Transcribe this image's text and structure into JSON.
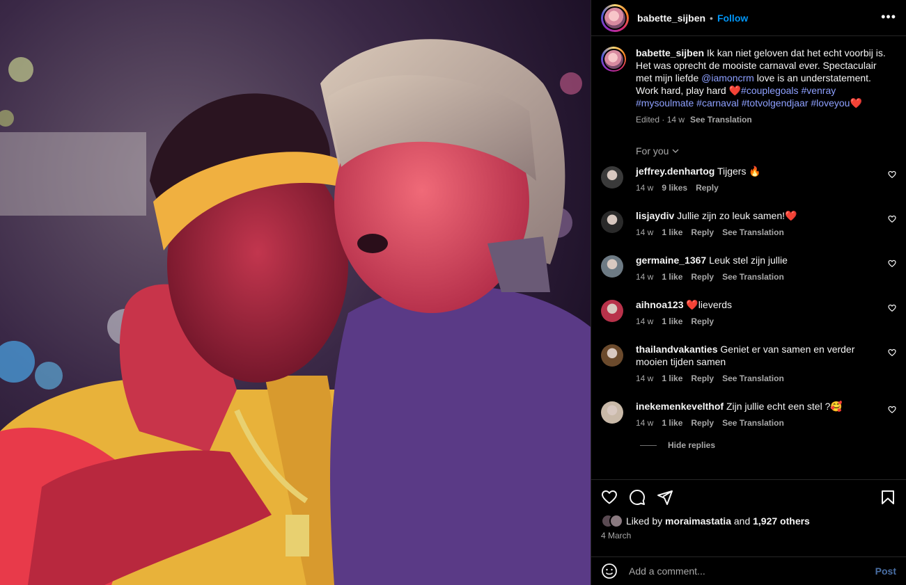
{
  "post": {
    "username": "babette_sijben",
    "follow_label": "Follow",
    "separator": "•"
  },
  "caption": {
    "username": "babette_sijben",
    "text_1": "Ik kan niet geloven dat het echt voorbij is. Het was oprecht de mooiste carnaval ever. Spectaculair met mijn liefde ",
    "mention": "@iamoncrm",
    "text_2": " love is an understatement. Work hard, play hard ",
    "emoji_heart": "❤️",
    "tags": [
      "#couplegoals",
      "#venray",
      "#mysoulmate",
      "#carnaval",
      "#totvolgendjaar",
      "#loveyou"
    ],
    "edited": "Edited · 14 w",
    "see_translation": "See Translation"
  },
  "for_you_label": "For you",
  "comments": [
    {
      "user": "jeffrey.denhartog",
      "text": "Tijgers 🔥",
      "time": "14 w",
      "likes": "9 likes",
      "reply": "Reply",
      "translate": "",
      "avatar_color": "#3a3a3a"
    },
    {
      "user": "lisjaydiv",
      "text": "Jullie zijn zo leuk samen!❤️",
      "time": "14 w",
      "likes": "1 like",
      "reply": "Reply",
      "translate": "See Translation",
      "avatar_color": "#2a2a2a"
    },
    {
      "user": "germaine_1367",
      "text": "Leuk stel zijn jullie",
      "time": "14 w",
      "likes": "1 like",
      "reply": "Reply",
      "translate": "See Translation",
      "avatar_color": "#6d7a84"
    },
    {
      "user": "aihnoa123",
      "text": "❤️lieverds",
      "time": "14 w",
      "likes": "1 like",
      "reply": "Reply",
      "translate": "",
      "avatar_color": "#b8324a"
    },
    {
      "user": "thailandvakanties",
      "text": "Geniet er van samen en verder mooien tijden samen",
      "time": "14 w",
      "likes": "1 like",
      "reply": "Reply",
      "translate": "See Translation",
      "avatar_color": "#6b4a2c"
    },
    {
      "user": "inekemenkevelthof",
      "text": "Zijn jullie echt een stel ?🥰",
      "time": "14 w",
      "likes": "1 like",
      "reply": "Reply",
      "translate": "See Translation",
      "avatar_color": "#c9b9a8"
    }
  ],
  "hide_replies": "Hide replies",
  "liked_by": {
    "prefix": "Liked by ",
    "user": "moraimastatia",
    "middle": " and ",
    "others": "1,927 others"
  },
  "date": "4 March",
  "add_comment": {
    "placeholder": "Add a comment...",
    "post_label": "Post"
  },
  "colors": {
    "accent": "#0095f6",
    "hashtag": "#8ea0ff",
    "muted": "#a8a8a8"
  }
}
